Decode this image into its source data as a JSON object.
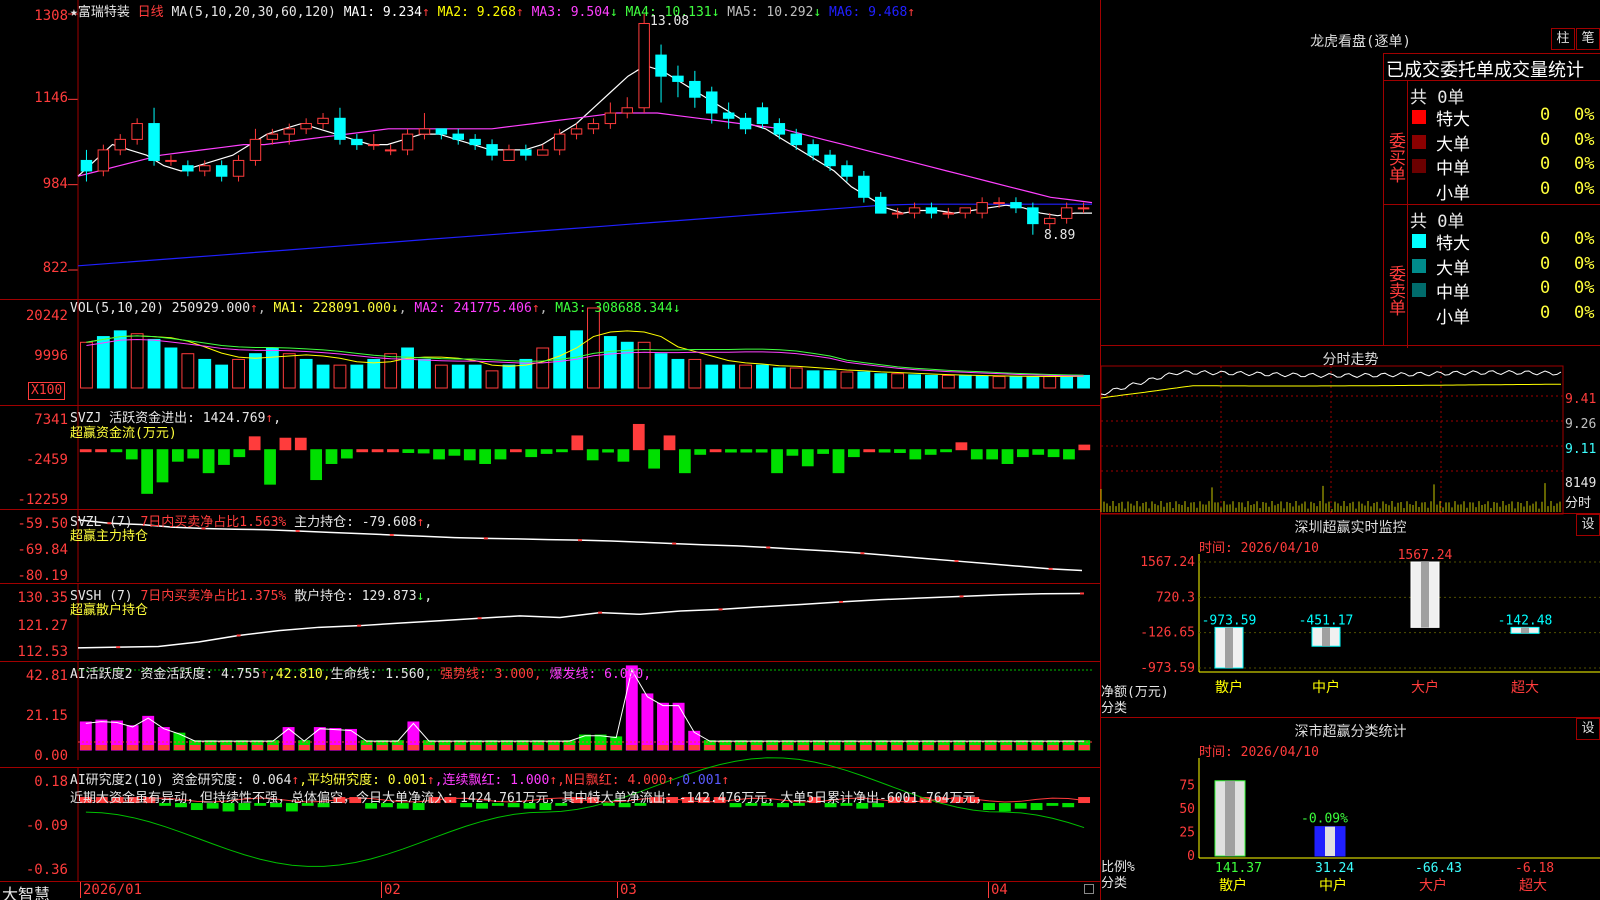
{
  "colors": {
    "up": "#ff3c3c",
    "down": "#00ffff",
    "grid": "#a00000",
    "ma1": "#ffffff",
    "ma2": "#ffff00",
    "ma3": "#ff40ff",
    "ma4": "#40ff40",
    "ma5": "#c0c0c0",
    "ma6": "#2020ff"
  },
  "main": {
    "star": "★",
    "stock_name": "富瑞特装",
    "period": "日线",
    "ma_label": "MA(5,10,20,30,60,120)",
    "ma_values": [
      {
        "label": "MA1:",
        "value": "9.234",
        "arrow": "↑",
        "color": "#ffffff"
      },
      {
        "label": "MA2:",
        "value": "9.268",
        "arrow": "↑",
        "color": "#ffff00"
      },
      {
        "label": "MA3:",
        "value": "9.504",
        "arrow": "↓",
        "color": "#ff40ff"
      },
      {
        "label": "MA4:",
        "value": "10.131",
        "arrow": "↓",
        "color": "#40ff40"
      },
      {
        "label": "MA5:",
        "value": "10.292",
        "arrow": "↓",
        "color": "#c0c0c0"
      },
      {
        "label": "MA6:",
        "value": "9.468",
        "arrow": "↑",
        "color": "#2020ff"
      }
    ],
    "y_ticks": [
      "1308",
      "1146",
      "984",
      "822"
    ],
    "high_label": "13.08",
    "low_label": "8.89"
  },
  "vol": {
    "title": "VOL(5,10,20)",
    "value": "250929.000",
    "v_arrow": "↑",
    "ma1": "MA1: 228091.000",
    "ma1_arrow": "↓",
    "ma2": "MA2: 241775.406",
    "ma2_arrow": "↑",
    "ma3": "MA3: 308688.344",
    "ma3_arrow": "↓",
    "y_ticks": [
      "20242",
      "9996"
    ],
    "unit": "X100"
  },
  "svzj": {
    "title": "SVZJ",
    "label": "活跃资金进出: 1424.769",
    "arrow": "↑",
    "sep": ",",
    "sub": "超赢资金流(万元)",
    "y_ticks": [
      "7341",
      "-2459",
      "-12259"
    ]
  },
  "svzl": {
    "title": "SVZL (7)",
    "ratio": "7日内买卖净占比1.563%",
    "label": "主力持仓: -79.608",
    "arrow": "↑",
    "sep": ",",
    "sub": "超赢主力持仓",
    "y_ticks": [
      "-59.50",
      "-69.84",
      "-80.19"
    ]
  },
  "svsh": {
    "title": "SVSH (7)",
    "ratio": "7日内买卖净占比1.375%",
    "label": "散户持仓: 129.873",
    "arrow": "↓",
    "sep": ",",
    "sub": "超赢散户持仓",
    "y_ticks": [
      "130.35",
      "121.27",
      "112.53"
    ]
  },
  "ai1": {
    "title": "AI活跃度2",
    "label": "资金活跃度: 4.755",
    "arrow": "↑",
    "v2": ",42.810,",
    "life": "生命线: 1.560,",
    "strong": "强势线: 3.000,",
    "burst": "爆发线: 6.000,",
    "y_ticks": [
      "42.81",
      "21.15",
      "0.00"
    ]
  },
  "ai2": {
    "title": "AI研究度2(10)",
    "label": "资金研究度: 0.064",
    "arrow": "↑",
    "avg": ",平均研究度: 0.001",
    "avg_arrow": "↑",
    "cons": ",连续飘红: 1.000",
    "cons_arrow": "↑",
    "n": ",N日飘红: 4.000",
    "n_arrow": "↑",
    "last": ",0.001",
    "last_arrow": "↑",
    "comment": "近期大资金虽有异动，但持续性不强，总体偏空，今日大单净流入：1424.761万元，其中特大单净流出：-142.476万元，大单5日累计净出-6001.764万元，",
    "y_ticks": [
      "0.18",
      "-0.09",
      "-0.36"
    ]
  },
  "footer": {
    "brand": "大智慧",
    "dates": [
      "2026/01",
      "02",
      "03",
      "04"
    ]
  },
  "dragon": {
    "title": "龙虎看盘(逐单)",
    "btn1": "柱",
    "btn2": "笔",
    "subtitle": "已成交委托单成交量统计",
    "buy": {
      "side": "委买单",
      "total": "共 0单",
      "rows": [
        {
          "name": "特大",
          "n": "0",
          "p": "0%",
          "color": "#ff0000"
        },
        {
          "name": "大单",
          "n": "0",
          "p": "0%",
          "color": "#8b0000"
        },
        {
          "name": "中单",
          "n": "0",
          "p": "0%",
          "color": "#6b0000"
        },
        {
          "name": "小单",
          "n": "0",
          "p": "0%",
          "color": "#000000"
        }
      ]
    },
    "sell": {
      "side": "委卖单",
      "total": "共 0单",
      "rows": [
        {
          "name": "特大",
          "n": "0",
          "p": "0%",
          "color": "#00ffff"
        },
        {
          "name": "大单",
          "n": "0",
          "p": "0%",
          "color": "#008b8b"
        },
        {
          "name": "中单",
          "n": "0",
          "p": "0%",
          "color": "#006b6b"
        },
        {
          "name": "小单",
          "n": "0",
          "p": "0%",
          "color": "#000000"
        }
      ]
    }
  },
  "intraday": {
    "title": "分时走势",
    "y_ticks": [
      "9.41",
      "9.26",
      "9.11"
    ],
    "vol_tick": "8149",
    "unit": "分时"
  },
  "monitor": {
    "title": "深圳超赢实时监控",
    "btn": "设",
    "time": "时间: 2026/04/10",
    "y_ticks": [
      "1567.24",
      "720.3",
      "-126.65",
      "-973.59"
    ],
    "axis_label": "净额(万元)",
    "cat_label": "分类",
    "bars": [
      {
        "name": "散户",
        "value": -973.59,
        "label": "-973.59"
      },
      {
        "name": "中户",
        "value": -451.17,
        "label": "-451.17"
      },
      {
        "name": "大户",
        "value": 1567.24,
        "label": "1567.24"
      },
      {
        "name": "超大",
        "value": -142.48,
        "label": "-142.48"
      }
    ]
  },
  "classify": {
    "title": "深市超赢分类统计",
    "btn": "设",
    "time": "时间: 2026/04/10",
    "y_ticks": [
      "75",
      "50",
      "25",
      "0"
    ],
    "axis_label": "比例%",
    "cat_label": "分类",
    "mid_label": "-0.09%",
    "bars": [
      {
        "name": "散户",
        "value": 141.37,
        "label": "141.37"
      },
      {
        "name": "中户",
        "value": 31.24,
        "label": "31.24"
      },
      {
        "name": "大户",
        "value": -66.43,
        "label": "-66.43"
      },
      {
        "name": "超大",
        "value": -6.18,
        "label": "-6.18"
      }
    ]
  },
  "chart_data": [
    {
      "type": "candlestick",
      "title": "富瑞特装 日线",
      "ylim": [
        8.22,
        13.08
      ],
      "y_ticks": [
        13.08,
        11.46,
        9.84,
        8.22
      ],
      "ohlc": [
        [
          10.3,
          10.5,
          9.9,
          10.1
        ],
        [
          10.1,
          10.6,
          10.0,
          10.5
        ],
        [
          10.5,
          10.8,
          10.4,
          10.7
        ],
        [
          10.7,
          11.1,
          10.6,
          11.0
        ],
        [
          11.0,
          11.3,
          10.2,
          10.3
        ],
        [
          10.3,
          10.4,
          10.2,
          10.3
        ],
        [
          10.2,
          10.3,
          10.0,
          10.1
        ],
        [
          10.1,
          10.3,
          10.0,
          10.2
        ],
        [
          10.2,
          10.3,
          9.9,
          10.0
        ],
        [
          10.0,
          10.4,
          9.9,
          10.3
        ],
        [
          10.3,
          10.9,
          10.2,
          10.7
        ],
        [
          10.7,
          10.9,
          10.6,
          10.8
        ],
        [
          10.8,
          11.0,
          10.6,
          10.9
        ],
        [
          10.9,
          11.1,
          10.8,
          11.0
        ],
        [
          11.0,
          11.2,
          10.9,
          11.1
        ],
        [
          11.1,
          11.3,
          10.6,
          10.7
        ],
        [
          10.7,
          10.8,
          10.5,
          10.6
        ],
        [
          10.6,
          10.8,
          10.5,
          10.6
        ],
        [
          10.5,
          10.6,
          10.4,
          10.5
        ],
        [
          10.5,
          10.9,
          10.4,
          10.8
        ],
        [
          10.8,
          11.2,
          10.7,
          10.9
        ],
        [
          10.9,
          10.9,
          10.7,
          10.8
        ],
        [
          10.8,
          10.9,
          10.6,
          10.7
        ],
        [
          10.7,
          10.8,
          10.5,
          10.6
        ],
        [
          10.6,
          10.7,
          10.3,
          10.4
        ],
        [
          10.3,
          10.6,
          10.3,
          10.5
        ],
        [
          10.5,
          10.6,
          10.3,
          10.4
        ],
        [
          10.4,
          10.6,
          10.4,
          10.5
        ],
        [
          10.5,
          10.9,
          10.4,
          10.8
        ],
        [
          10.8,
          11.0,
          10.7,
          10.9
        ],
        [
          10.9,
          11.1,
          10.8,
          11.0
        ],
        [
          11.0,
          11.4,
          10.9,
          11.2
        ],
        [
          11.2,
          11.5,
          11.1,
          11.3
        ],
        [
          11.3,
          13.08,
          11.2,
          12.9
        ],
        [
          12.3,
          12.5,
          11.4,
          11.9
        ],
        [
          11.9,
          12.1,
          11.5,
          11.8
        ],
        [
          11.8,
          12.0,
          11.3,
          11.5
        ],
        [
          11.6,
          11.7,
          11.0,
          11.2
        ],
        [
          11.2,
          11.4,
          10.9,
          11.1
        ],
        [
          11.1,
          11.2,
          10.8,
          10.9
        ],
        [
          11.3,
          11.4,
          10.9,
          11.0
        ],
        [
          11.0,
          11.1,
          10.7,
          10.8
        ],
        [
          10.8,
          10.9,
          10.5,
          10.6
        ],
        [
          10.6,
          10.7,
          10.3,
          10.4
        ],
        [
          10.4,
          10.5,
          10.1,
          10.2
        ],
        [
          10.2,
          10.3,
          9.9,
          10.0
        ],
        [
          10.0,
          10.1,
          9.5,
          9.6
        ],
        [
          9.6,
          9.7,
          9.3,
          9.3
        ],
        [
          9.3,
          9.4,
          9.2,
          9.3
        ],
        [
          9.3,
          9.5,
          9.2,
          9.4
        ],
        [
          9.4,
          9.5,
          9.2,
          9.3
        ],
        [
          9.3,
          9.4,
          9.2,
          9.3
        ],
        [
          9.3,
          9.4,
          9.2,
          9.4
        ],
        [
          9.3,
          9.6,
          9.2,
          9.5
        ],
        [
          9.5,
          9.6,
          9.4,
          9.5
        ],
        [
          9.5,
          9.6,
          9.3,
          9.4
        ],
        [
          9.4,
          9.5,
          8.89,
          9.1
        ],
        [
          9.1,
          9.3,
          9.0,
          9.2
        ],
        [
          9.2,
          9.5,
          9.1,
          9.4
        ],
        [
          9.4,
          9.5,
          9.3,
          9.4
        ]
      ],
      "ma": [
        {
          "name": "MA1",
          "color": "#ffffff",
          "values": [
            10.0,
            10.3,
            10.6,
            10.5,
            10.4,
            10.2,
            10.1,
            10.2,
            10.3,
            10.4,
            10.6,
            10.8,
            10.9,
            11.0,
            10.9,
            10.8,
            10.7,
            10.6,
            10.6,
            10.7,
            10.8,
            10.8,
            10.7,
            10.6,
            10.5,
            10.5,
            10.5,
            10.6,
            10.8,
            11.0,
            11.3,
            11.6,
            11.9,
            12.1,
            12.0,
            11.8,
            11.6,
            11.4,
            11.2,
            11.0,
            10.9,
            10.7,
            10.5,
            10.3,
            10.1,
            9.8,
            9.6,
            9.4,
            9.3,
            9.35,
            9.35,
            9.3,
            9.35,
            9.4,
            9.45,
            9.4,
            9.3,
            9.25,
            9.3,
            9.3
          ]
        },
        {
          "name": "MA3",
          "color": "#ff40ff",
          "values": [
            10.0,
            10.1,
            10.2,
            10.3,
            10.4,
            10.45,
            10.5,
            10.55,
            10.6,
            10.6,
            10.65,
            10.7,
            10.75,
            10.8,
            10.85,
            10.9,
            10.9,
            10.9,
            10.9,
            10.9,
            10.9,
            10.95,
            11.0,
            11.05,
            11.1,
            11.15,
            11.2,
            11.2,
            11.2,
            11.15,
            11.1,
            11.05,
            11.0,
            10.95,
            10.9,
            10.8,
            10.7,
            10.6,
            10.5,
            10.4,
            10.3,
            10.2,
            10.1,
            10.0,
            9.9,
            9.8,
            9.7,
            9.6,
            9.55,
            9.5
          ]
        },
        {
          "name": "MA6",
          "color": "#2020ff",
          "values": [
            8.3,
            8.35,
            8.4,
            8.45,
            8.5,
            8.55,
            8.6,
            8.65,
            8.7,
            8.75,
            8.8,
            8.85,
            8.9,
            8.95,
            9.0,
            9.05,
            9.1,
            9.15,
            9.2,
            9.25,
            9.3,
            9.35,
            9.4,
            9.45,
            9.47,
            9.47,
            9.47,
            9.47,
            9.47,
            9.47
          ]
        }
      ]
    },
    {
      "type": "bar",
      "title": "VOL(5,10,20)",
      "ylim": [
        0,
        20242
      ],
      "values": [
        8,
        9,
        10,
        9.5,
        8.5,
        7,
        6,
        5,
        4,
        5,
        6,
        7,
        6,
        5,
        4,
        4,
        4,
        5,
        6,
        7,
        5,
        4,
        4,
        4,
        3,
        4,
        5,
        7,
        9,
        10,
        14,
        9,
        8,
        8,
        6,
        5,
        5,
        4,
        4,
        4,
        4,
        3.5,
        3.5,
        3,
        3,
        2.8,
        2.8,
        2.5,
        2.5,
        2.3,
        2.2,
        2.2,
        2.1,
        2.1,
        2,
        2,
        2,
        2,
        2.1,
        2.2
      ]
    },
    {
      "type": "bar",
      "title": "超赢资金流(万元)",
      "ylim": [
        -12259,
        7341
      ],
      "values": [
        0,
        0,
        -400,
        -2000,
        -9500,
        -7000,
        -2500,
        -1800,
        -5000,
        -3200,
        -1500,
        2800,
        -7500,
        2500,
        2500,
        -6500,
        -3000,
        -1800,
        0,
        0,
        0,
        -600,
        -700,
        -2000,
        -1200,
        -2200,
        -3000,
        -2000,
        0,
        -1500,
        -800,
        -300,
        3000,
        -2200,
        -500,
        -2500,
        5500,
        -4000,
        3000,
        -5000,
        -1000,
        0,
        -500,
        -500,
        -500,
        -5000,
        -1200,
        -3500,
        -800,
        -5000,
        -1500,
        0,
        -500,
        -600,
        -2000,
        -1000,
        -300,
        1500,
        -2000,
        -2000,
        -3000,
        -1500,
        -1000,
        -1500,
        -2000,
        1000
      ]
    },
    {
      "type": "line",
      "title": "超赢主力持仓",
      "ylim": [
        -80.19,
        -59.5
      ],
      "values": [
        -60.2,
        -61.5,
        -62.0,
        -63.0,
        -63.5,
        -63.8,
        -64.0,
        -64.5,
        -65.0,
        -65.5,
        -66.0,
        -66.5,
        -67.0,
        -67.3,
        -67.5,
        -67.8,
        -68.0,
        -68.3,
        -68.8,
        -69.3,
        -69.8,
        -70.2,
        -70.8,
        -71.5,
        -72.2,
        -73.0,
        -74.0,
        -75.0,
        -76.0,
        -77.0,
        -78.0,
        -79.0,
        -79.6
      ]
    },
    {
      "type": "line",
      "title": "超赢散户持仓",
      "ylim": [
        112.53,
        130.35
      ],
      "values": [
        113.2,
        113.4,
        113.6,
        115.0,
        117.0,
        118.5,
        119.5,
        120.0,
        120.8,
        121.5,
        122.3,
        123.0,
        122.5,
        124.0,
        123.5,
        124.5,
        125.0,
        125.8,
        126.5,
        127.3,
        128.0,
        128.5,
        129.0,
        129.5,
        129.8,
        129.9
      ]
    },
    {
      "type": "bar",
      "title": "AI活跃度2",
      "ylim": [
        0,
        42.81
      ],
      "values": [
        15,
        16,
        15.5,
        13,
        18,
        12,
        9,
        5,
        5,
        5,
        5,
        5,
        5,
        12,
        5,
        12,
        11.5,
        11,
        5,
        5,
        5,
        15,
        5,
        5,
        5,
        5,
        5,
        5,
        5,
        5,
        5,
        5,
        8,
        8,
        7,
        45,
        30,
        25,
        25,
        10,
        5,
        5,
        5,
        5,
        5,
        5,
        5,
        5,
        5,
        5,
        5,
        5,
        5,
        5,
        5,
        5,
        5,
        5,
        5,
        5,
        5,
        5,
        5,
        5,
        5
      ]
    },
    {
      "type": "bar",
      "title": "AI研究度2(10)",
      "ylim": [
        -0.36,
        0.18
      ],
      "values": [
        0.02,
        0.02,
        0.02,
        0.02,
        0.05,
        -0.02,
        -0.03,
        -0.05,
        -0.04,
        -0.06,
        -0.05,
        -0.02,
        -0.03,
        -0.06,
        -0.02,
        -0.03,
        0.02,
        0.02,
        -0.04,
        -0.03,
        -0.04,
        -0.05,
        0.02,
        0.02,
        -0.03,
        -0.04,
        -0.02,
        -0.03,
        -0.04,
        -0.05,
        -0.02,
        0.02,
        0.02,
        -0.02,
        -0.03,
        -0.02,
        0.03,
        0.02,
        0.02,
        0.02,
        0.02,
        -0.03,
        -0.02,
        -0.02,
        -0.03,
        -0.02,
        0.02,
        -0.03,
        -0.02,
        -0.04,
        -0.03,
        0.02,
        0.02,
        0.02,
        0.02,
        0.02,
        0.02,
        -0.05,
        -0.06,
        -0.04,
        -0.05,
        -0.02,
        -0.03,
        0.05
      ]
    }
  ]
}
